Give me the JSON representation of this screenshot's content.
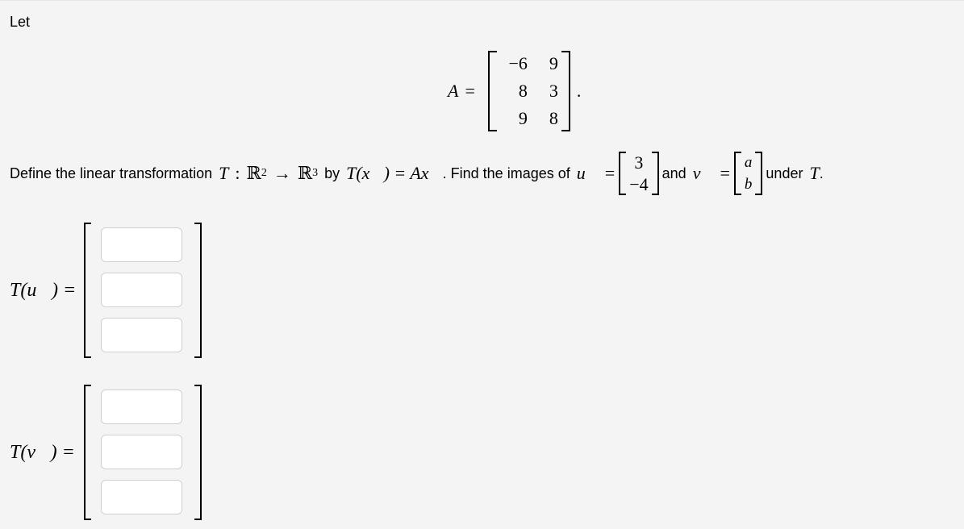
{
  "intro": "Let",
  "matrix_A": {
    "name": "A",
    "equals": "=",
    "rows": [
      [
        "−6",
        "9"
      ],
      [
        "8",
        "3"
      ],
      [
        "9",
        "8"
      ]
    ],
    "trailing": "."
  },
  "definition": {
    "text1": "Define the linear transformation",
    "T": "T",
    "colon": ":",
    "domain": "ℝ",
    "domain_exp": "2",
    "arrow": "→",
    "codomain": "ℝ",
    "codomain_exp": "3",
    "text2": "by",
    "Tx": "T(x⃗) = Ax⃗",
    "text3": ". Find the images of",
    "u_label": "u⃗ =",
    "u": [
      "3",
      "−4"
    ],
    "text4": "and",
    "v_label": "v⃗ =",
    "v": [
      "a",
      "b"
    ],
    "text5": "under",
    "T2": "T",
    "period": "."
  },
  "answers": {
    "u": {
      "label": "T(u⃗) =",
      "values": [
        "",
        "",
        ""
      ],
      "placeholders": [
        "",
        "",
        ""
      ]
    },
    "v": {
      "label": "T(v⃗) =",
      "values": [
        "",
        "",
        ""
      ],
      "placeholders": [
        "",
        "",
        ""
      ]
    }
  }
}
